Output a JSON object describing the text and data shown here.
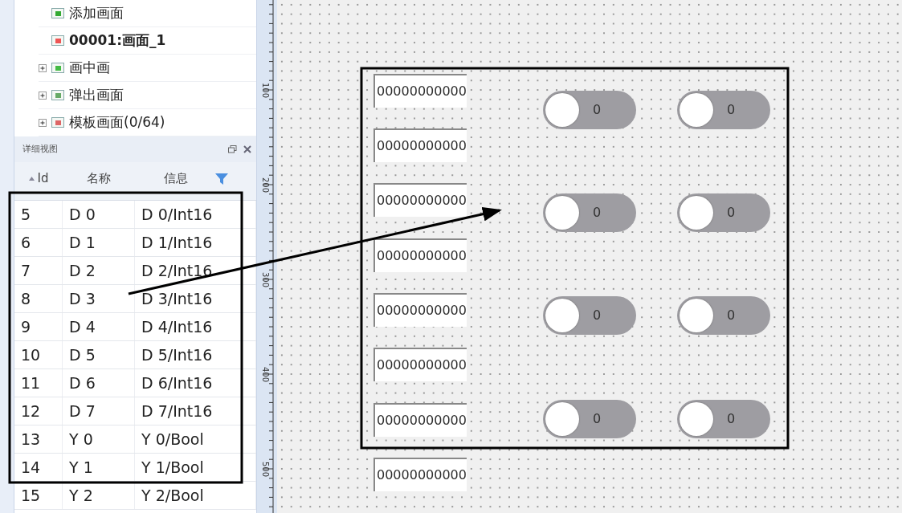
{
  "tree": {
    "items": [
      {
        "label": "添加画面",
        "kind": "add",
        "expandable": false,
        "active": false
      },
      {
        "label": "00001:画面_1",
        "kind": "screen",
        "expandable": false,
        "active": true
      },
      {
        "label": "画中画",
        "kind": "inner",
        "expandable": true,
        "active": false
      },
      {
        "label": "弹出画面",
        "kind": "popup",
        "expandable": true,
        "active": false
      },
      {
        "label": "模板画面(0/64)",
        "kind": "template",
        "expandable": true,
        "active": false
      }
    ]
  },
  "detail_view": {
    "title": "详细视图",
    "columns": [
      {
        "label": "Id",
        "sorted": true,
        "filter": false
      },
      {
        "label": "名称",
        "sorted": false,
        "filter": false
      },
      {
        "label": "信息",
        "sorted": false,
        "filter": true
      }
    ],
    "rows": [
      [
        "5",
        "D 0",
        "D 0/Int16"
      ],
      [
        "6",
        "D 1",
        "D 1/Int16"
      ],
      [
        "7",
        "D 2",
        "D 2/Int16"
      ],
      [
        "8",
        "D 3",
        "D 3/Int16"
      ],
      [
        "9",
        "D 4",
        "D 4/Int16"
      ],
      [
        "10",
        "D 5",
        "D 5/Int16"
      ],
      [
        "11",
        "D 6",
        "D 6/Int16"
      ],
      [
        "12",
        "D 7",
        "D 7/Int16"
      ],
      [
        "13",
        "Y 0",
        "Y 0/Bool"
      ],
      [
        "14",
        "Y 1",
        "Y 1/Bool"
      ],
      [
        "15",
        "Y 2",
        "Y 2/Bool"
      ]
    ]
  },
  "ruler": {
    "labels": [
      "100",
      "200",
      "300",
      "400",
      "500"
    ]
  },
  "canvas": {
    "fields": [
      {
        "value": "00000000000"
      },
      {
        "value": "00000000000"
      },
      {
        "value": "00000000000"
      },
      {
        "value": "00000000000"
      },
      {
        "value": "00000000000"
      },
      {
        "value": "00000000000"
      },
      {
        "value": "00000000000"
      },
      {
        "value": "00000000000"
      }
    ],
    "toggles": [
      {
        "label": "0",
        "on": false
      },
      {
        "label": "0",
        "on": false
      },
      {
        "label": "0",
        "on": false
      },
      {
        "label": "0",
        "on": false
      },
      {
        "label": "0",
        "on": false
      },
      {
        "label": "0",
        "on": false
      },
      {
        "label": "0",
        "on": false
      },
      {
        "label": "0",
        "on": false
      }
    ]
  }
}
